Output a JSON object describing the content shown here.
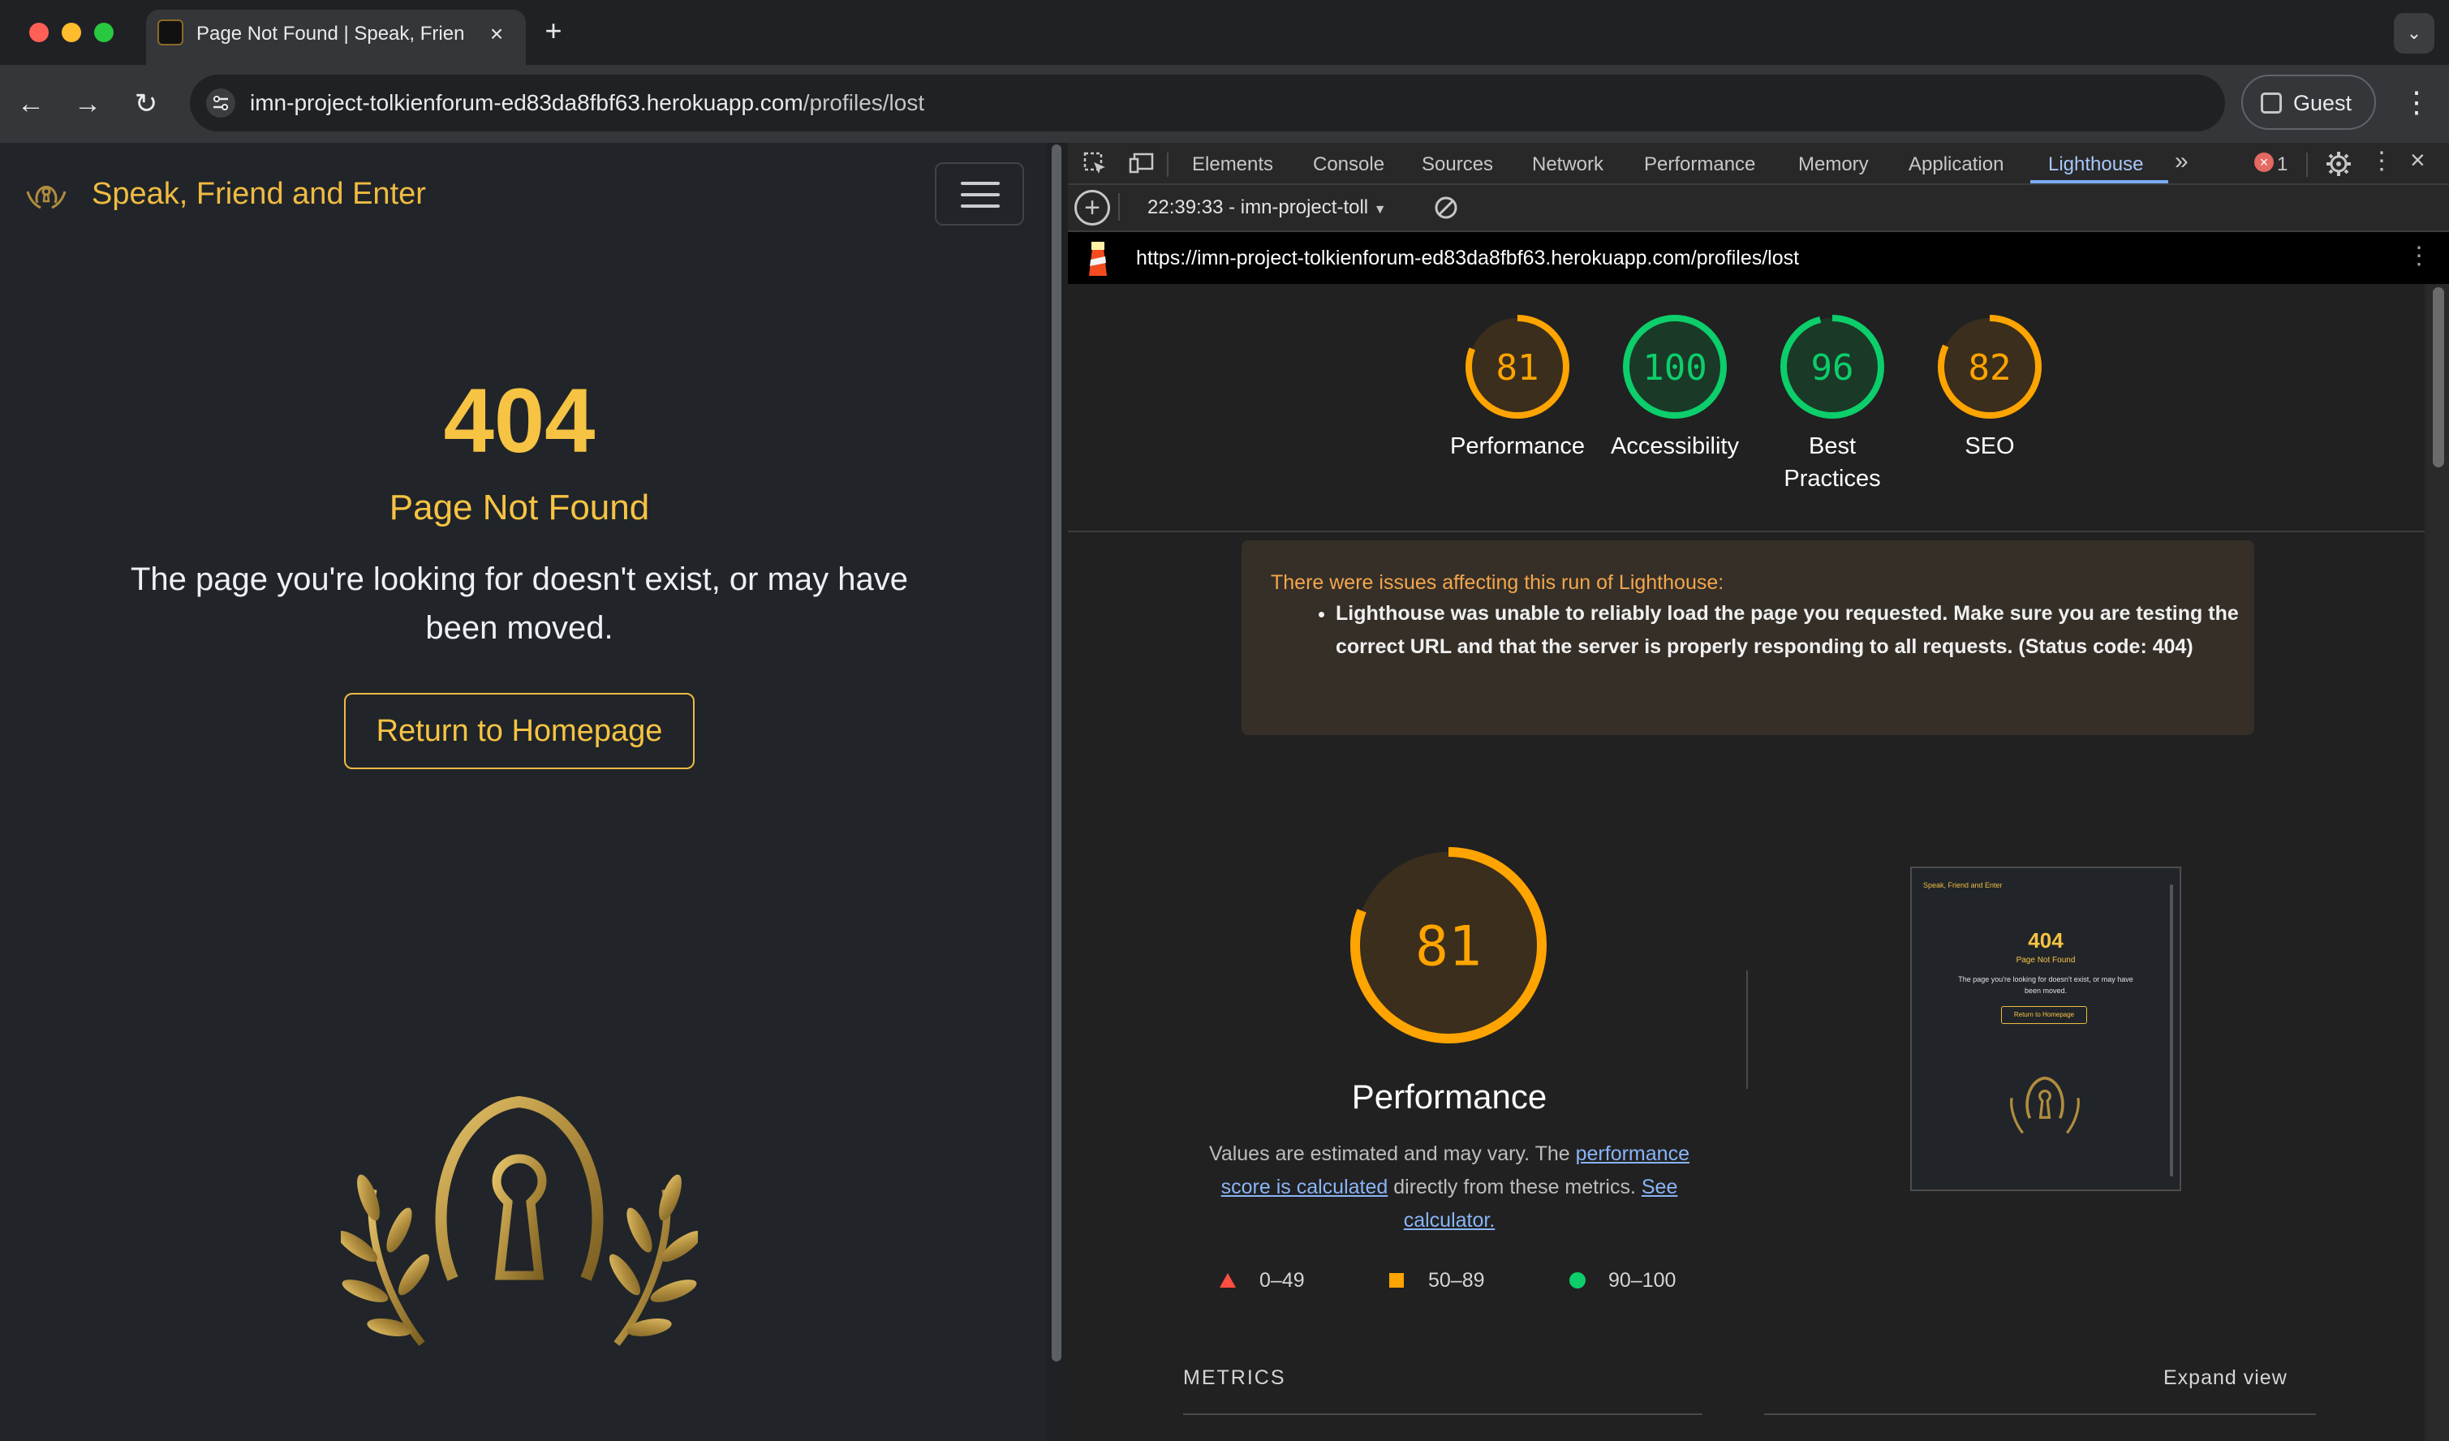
{
  "browser": {
    "tab_title": "Page Not Found | Speak, Friend and Enter",
    "new_tab_symbol": "+",
    "url_host": "imn-project-tolkienforum-ed83da8fbf63.herokuapp.com",
    "url_path": "/profiles/lost",
    "profile_label": "Guest",
    "icons": [
      "back-icon",
      "forward-icon",
      "reload-icon",
      "site-info-icon",
      "profile-icon",
      "more-icon",
      "tab-search-icon"
    ]
  },
  "page": {
    "brand": "Speak, Friend and Enter",
    "error_code": "404",
    "error_title": "Page Not Found",
    "error_message": "The page you're looking for doesn't exist, or may have been moved.",
    "home_button": "Return to Homepage"
  },
  "devtools": {
    "tabs": [
      "Elements",
      "Console",
      "Sources",
      "Network",
      "Performance",
      "Memory",
      "Application",
      "Lighthouse"
    ],
    "active_tab": "Lighthouse",
    "error_count": "1",
    "report_selector": "22:39:33 - imn-project-toll",
    "report_url": "https://imn-project-tolkienforum-ed83da8fbf63.herokuapp.com/profiles/lost",
    "scores": [
      {
        "label": "Performance",
        "value": "81",
        "fraction": 0.81,
        "color": "#ffa400"
      },
      {
        "label": "Accessibility",
        "value": "100",
        "fraction": 1.0,
        "color": "#0cce6b"
      },
      {
        "label_line1": "Best",
        "label_line2": "Practices",
        "value": "96",
        "fraction": 0.96,
        "color": "#0cce6b"
      },
      {
        "label": "SEO",
        "value": "82",
        "fraction": 0.82,
        "color": "#ffa400"
      }
    ],
    "warning": {
      "title": "There were issues affecting this run of Lighthouse:",
      "item": "Lighthouse was unable to reliably load the page you requested. Make sure you are testing the correct URL and that the server is properly responding to all requests. (Status code: 404)"
    },
    "performance": {
      "score": "81",
      "fraction": 0.81,
      "title": "Performance",
      "note_pre": "Values are estimated and may vary. The ",
      "note_link1": "performance score is calculated",
      "note_mid": " directly from these metrics. ",
      "note_link2": "See calculator.",
      "legend": [
        "0–49",
        "50–89",
        "90–100"
      ]
    },
    "thumbnail": {
      "brand": "Speak, Friend and Enter",
      "code": "404",
      "title": "Page Not Found",
      "message": "The page you're looking for doesn't exist, or may have been moved.",
      "button": "Return to Homepage"
    },
    "metrics_label": "METRICS",
    "expand_label": "Expand view"
  },
  "colors": {
    "accent_gold": "#f6c343",
    "lh_orange": "#ffa400",
    "lh_green": "#0cce6b",
    "lh_red": "#ff4e42",
    "link_blue": "#8ab4f8"
  }
}
